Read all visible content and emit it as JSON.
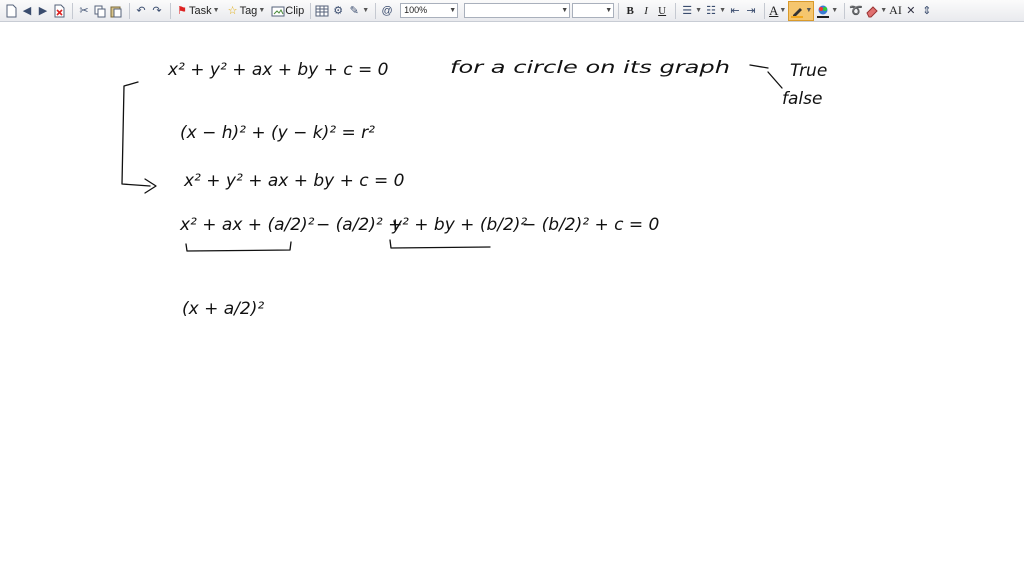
{
  "toolbar": {
    "task_label": "Task",
    "tag_label": "Tag",
    "clip_label": "Clip",
    "zoom_value": "100%",
    "bold_label": "B",
    "italic_label": "I",
    "underline_label": "U",
    "font_color_label": "A",
    "text_size_label": "AI",
    "accent_color": "#f5a623",
    "highlight_color": "#f2a81d"
  },
  "note": {
    "line1": "x² + y² + ax + by + c = 0",
    "line1_comment": "for a circle on its graph",
    "answer_true": "True",
    "answer_false": "false",
    "line2": "(x − h)² + (y − k)² = r²",
    "line3": "x² + y²  + ax + by + c = 0",
    "line4_a": "x² + ax + (a/2)²",
    "line4_b": "− (a/2)²  +",
    "line4_c": "y² + by + (b/2)²",
    "line4_d": "− (b/2)²  + c = 0",
    "line5": "(x + a/2)²"
  }
}
